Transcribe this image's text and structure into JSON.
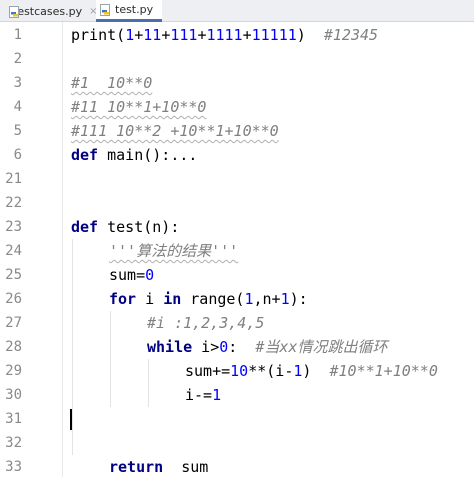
{
  "tabs": [
    {
      "label": "testcases.py",
      "active": false
    },
    {
      "label": "test.py",
      "active": true
    }
  ],
  "close_glyph": "×",
  "editor": {
    "line_numbers": [
      "1",
      "2",
      "3",
      "4",
      "5",
      "6",
      "21",
      "22",
      "23",
      "24",
      "25",
      "26",
      "27",
      "28",
      "29",
      "30",
      "31",
      "32",
      "33"
    ],
    "lines": {
      "l1": {
        "fn": "print",
        "p1": "(",
        "n1": "1",
        "plus1": "+",
        "n2": "11",
        "plus2": "+",
        "n3": "111",
        "plus3": "+",
        "n4": "1111",
        "plus4": "+",
        "n5": "11111",
        "p2": ")",
        "comment": "#12345"
      },
      "l3": {
        "comment": "#1  10**0"
      },
      "l4": {
        "comment": "#11 10**1+10**0"
      },
      "l5": {
        "comment": "#111 10**2 +10**1+10**0"
      },
      "l6": {
        "kw": "def",
        "rest": " main():..."
      },
      "l23": {
        "kw": "def",
        "rest": " test(n):"
      },
      "l24": {
        "docstring": "'''算法的结果'''"
      },
      "l25": {
        "a": "sum=",
        "num": "0"
      },
      "l26": {
        "kw_for": "for",
        "a": " i ",
        "kw_in": "in",
        "b": " range(",
        "num1": "1",
        "c": ",n+",
        "num2": "1",
        "d": "):"
      },
      "l27": {
        "comment": "#i :1,2,3,4,5"
      },
      "l28": {
        "kw": "while",
        "a": " i>",
        "num": "0",
        "b": ":  ",
        "comment": "#当xx情况跳出循环"
      },
      "l29": {
        "a": "sum+=",
        "num1": "10",
        "b": "**(i-",
        "num2": "1",
        "c": ")  ",
        "comment": "#10**1+10**0"
      },
      "l30": {
        "a": "i-=",
        "num": "1"
      },
      "l33": {
        "kw": "return",
        "rest": "  sum"
      }
    }
  },
  "colors": {
    "keyword": "#000080",
    "number": "#0000ff",
    "comment": "#808080",
    "tab_active_underline": "#4b6eaf",
    "python_icon_blue": "#3f7cbf",
    "python_icon_yellow": "#f5c518"
  },
  "icons": [
    "python-file-icon",
    "close-icon"
  ]
}
